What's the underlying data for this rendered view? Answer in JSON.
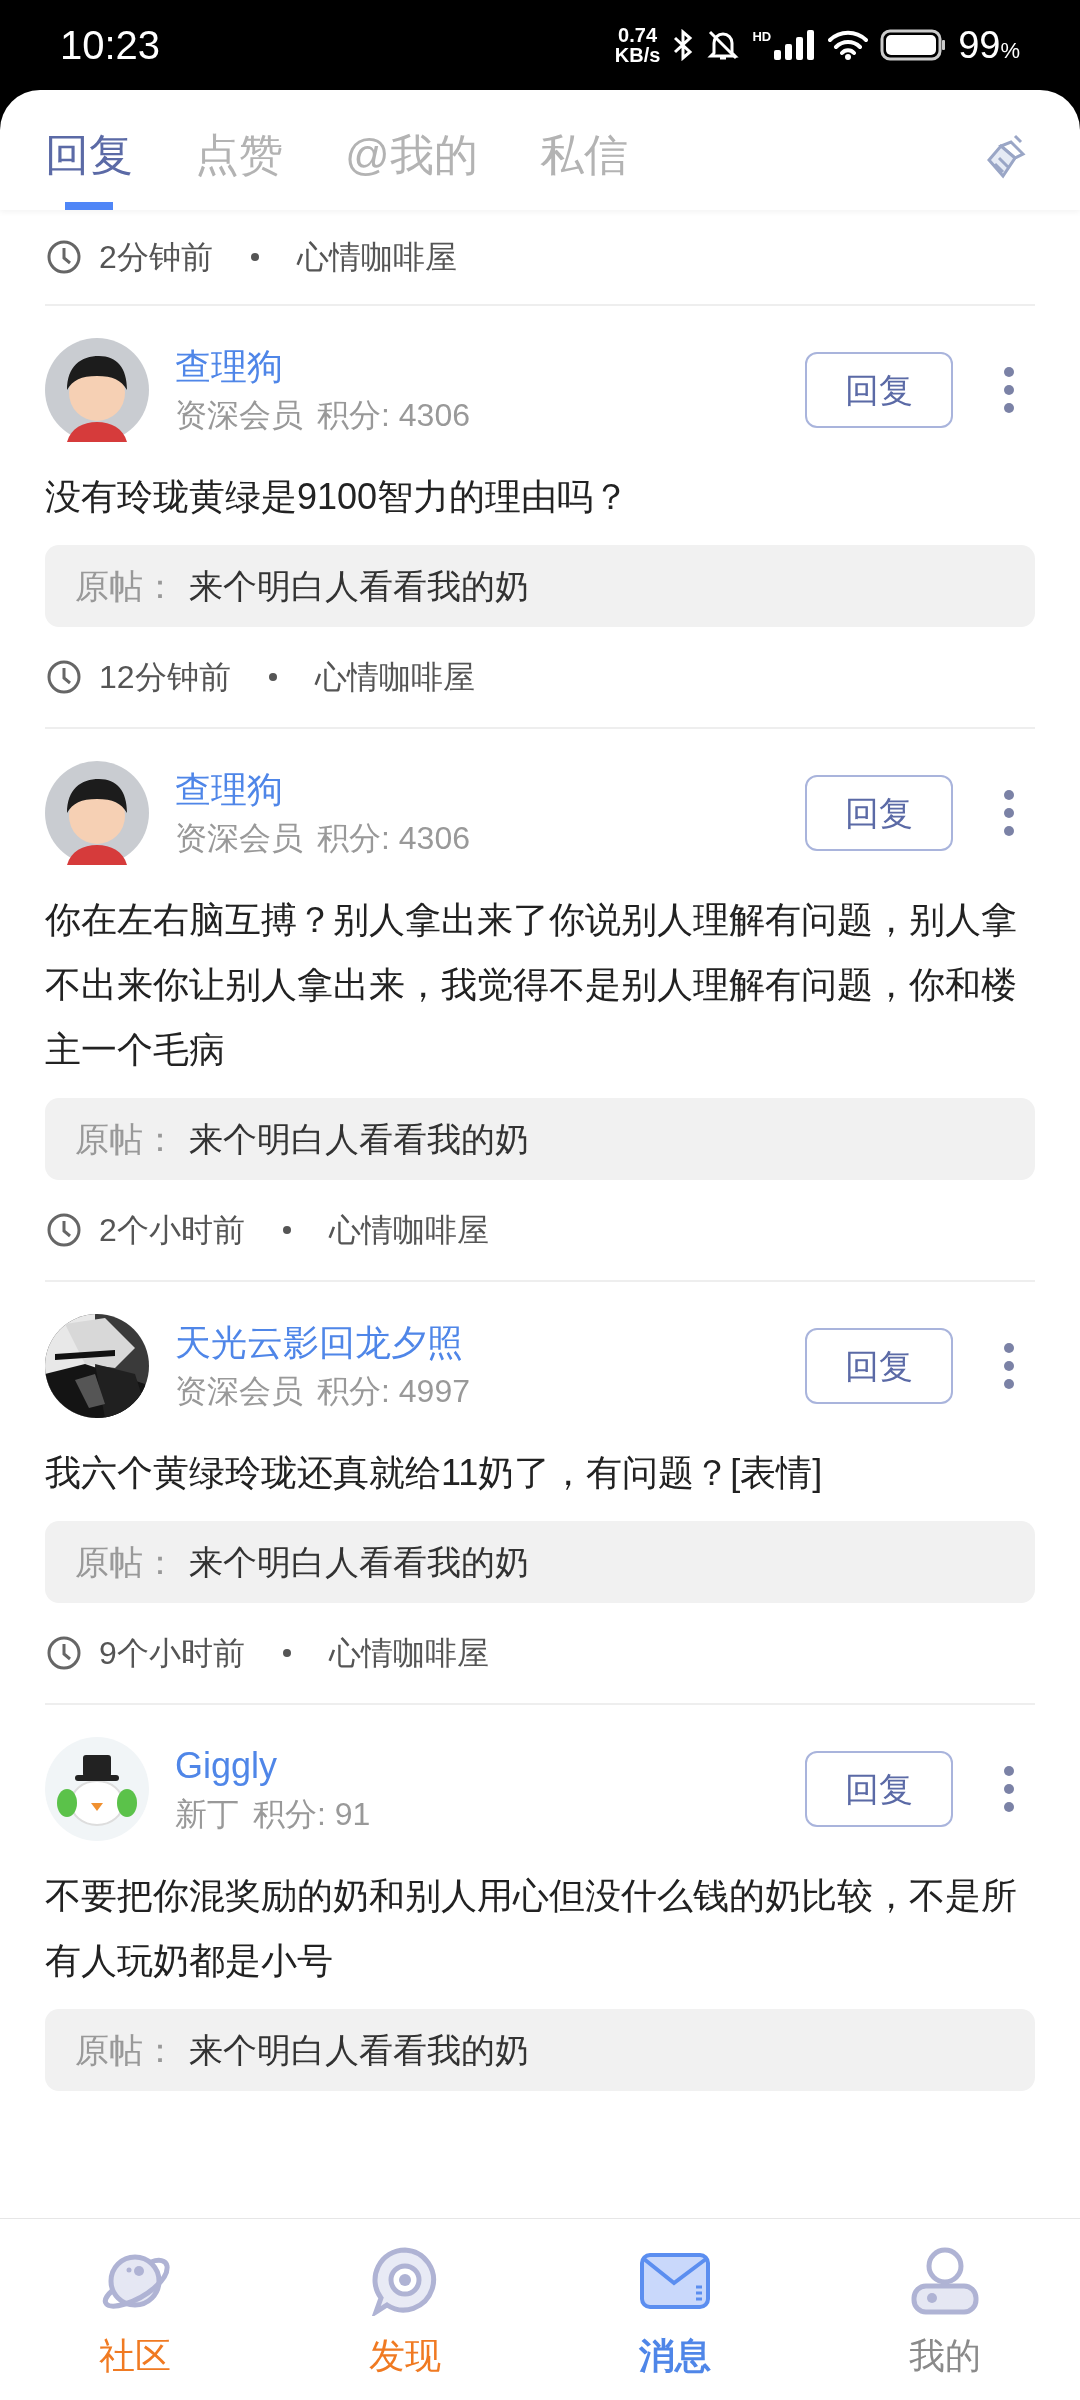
{
  "status_bar": {
    "time": "10:23",
    "net_speed": "0.74",
    "net_unit": "KB/s",
    "network_type": "HD",
    "battery": "99",
    "battery_unit": "%"
  },
  "tabs": [
    {
      "label": "回复",
      "selected": true
    },
    {
      "label": "点赞",
      "selected": false
    },
    {
      "label": "@我的",
      "selected": false
    },
    {
      "label": "私信",
      "selected": false
    }
  ],
  "previous_item": {
    "time": "2分钟前",
    "forum": "心情咖啡屋"
  },
  "replies": [
    {
      "avatar": {
        "kind": "boy"
      },
      "name": "查理狗",
      "rank": "资深会员",
      "points": "积分: 4306",
      "reply_button": "回复",
      "text": "没有玲珑黄绿是9100智力的理由吗？",
      "original_label": "原帖：",
      "original_title": "来个明白人看看我的奶",
      "time": "12分钟前",
      "forum": "心情咖啡屋"
    },
    {
      "avatar": {
        "kind": "boy"
      },
      "name": "查理狗",
      "rank": "资深会员",
      "points": "积分: 4306",
      "reply_button": "回复",
      "text": "你在左右脑互搏？别人拿出来了你说别人理解有问题，别人拿不出来你让别人拿出来，我觉得不是别人理解有问题，你和楼主一个毛病",
      "original_label": "原帖：",
      "original_title": "来个明白人看看我的奶",
      "time": "2个小时前",
      "forum": "心情咖啡屋"
    },
    {
      "name": "天光云影回龙夕照",
      "rank": "资深会员",
      "points": "积分: 4997",
      "reply_button": "回复",
      "text": "我六个黄绿玲珑还真就给11奶了，有问题？[表情]",
      "original_label": "原帖：",
      "original_title": "来个明白人看看我的奶",
      "time": "9个小时前",
      "forum": "心情咖啡屋"
    },
    {
      "avatar": {
        "kind": "snowman"
      },
      "name": "Giggly",
      "rank": "新丁",
      "points": "积分: 91",
      "reply_button": "回复",
      "text": "不要把你混奖励的奶和别人用心但没什么钱的奶比较，不是所有人玩奶都是小号",
      "original_label": "原帖：",
      "original_title": "来个明白人看看我的奶"
    }
  ],
  "bottom_nav": [
    {
      "label": "社区",
      "color": "#f07a22",
      "selected": false
    },
    {
      "label": "发现",
      "color": "#f07a22",
      "selected": false
    },
    {
      "label": "消息",
      "color": "#4f86e8",
      "selected": true
    },
    {
      "label": "我的",
      "color": "#8a8a8a",
      "selected": false
    }
  ]
}
